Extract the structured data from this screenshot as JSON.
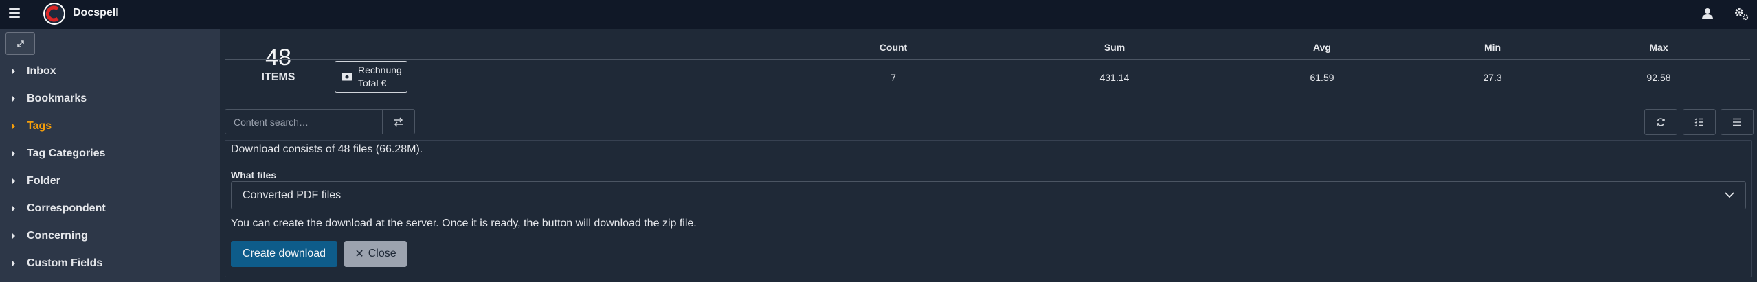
{
  "app": {
    "title": "Docspell"
  },
  "sidebar": {
    "items": [
      {
        "label": "Inbox",
        "active": false
      },
      {
        "label": "Bookmarks",
        "active": false
      },
      {
        "label": "Tags",
        "active": true
      },
      {
        "label": "Tag Categories",
        "active": false
      },
      {
        "label": "Folder",
        "active": false
      },
      {
        "label": "Correspondent",
        "active": false
      },
      {
        "label": "Concerning",
        "active": false
      },
      {
        "label": "Custom Fields",
        "active": false
      }
    ]
  },
  "summary": {
    "count": "48",
    "count_label": "ITEMS",
    "field": {
      "line1": "Rechnung",
      "line2": "Total €"
    },
    "headers": [
      "Count",
      "Sum",
      "Avg",
      "Min",
      "Max"
    ],
    "values": [
      "7",
      "431.14",
      "61.59",
      "27.3",
      "92.58"
    ]
  },
  "search": {
    "placeholder": "Content search…"
  },
  "download": {
    "info": "Download consists of 48 files (66.28M).",
    "what_files_label": "What files",
    "selected_option": "Converted PDF files",
    "help": "You can create the download at the server. Once it is ready, the button will download the zip file.",
    "create_label": "Create download",
    "close_label": "Close"
  },
  "colors": {
    "topbar": "#101827",
    "sidebar": "#2d3748",
    "main": "#1f2937",
    "active": "#f59e0b",
    "primary_button": "#0e5c8a",
    "secondary_button": "#9ca3af"
  }
}
